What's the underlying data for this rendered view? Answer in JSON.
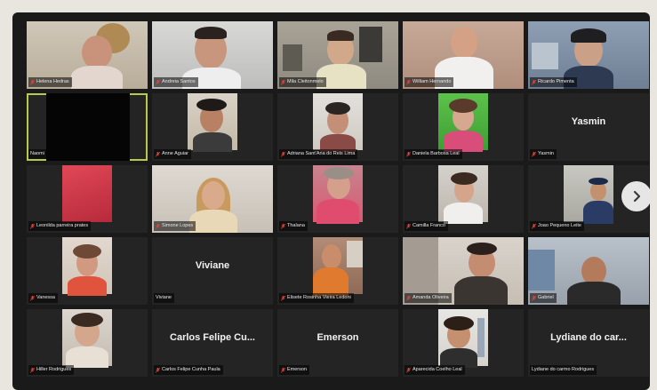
{
  "meeting": {
    "next_page_icon": "chevron-right-icon",
    "muted_icon": "mic-off-icon",
    "accent": "#b9c94a",
    "participants": [
      {
        "label": "Helena Hedras",
        "big_name": ""
      },
      {
        "label": "Andreia Santos",
        "big_name": ""
      },
      {
        "label": "Mila Cleitonmelo",
        "big_name": ""
      },
      {
        "label": "William Hernando",
        "big_name": ""
      },
      {
        "label": "Ricardo Pimenta",
        "big_name": ""
      },
      {
        "label": "Naomi",
        "big_name": ""
      },
      {
        "label": "Anne Aguiar",
        "big_name": ""
      },
      {
        "label": "Adriana Sant'Ana do Reis Lima",
        "big_name": ""
      },
      {
        "label": "Daniela Barbosa Leal",
        "big_name": ""
      },
      {
        "label": "Yasmin",
        "big_name": "Yasmin"
      },
      {
        "label": "Leonilda parreira prates",
        "big_name": ""
      },
      {
        "label": "Simone Lopes",
        "big_name": ""
      },
      {
        "label": "Thalana",
        "big_name": ""
      },
      {
        "label": "Camilla Franco",
        "big_name": ""
      },
      {
        "label": "Joao Pequeno Leite",
        "big_name": ""
      },
      {
        "label": "Vanessa",
        "big_name": ""
      },
      {
        "label": "Viviane",
        "big_name": "Viviane"
      },
      {
        "label": "Elisete Rosinha Vieira Ledoni",
        "big_name": ""
      },
      {
        "label": "Amanda Oliveira",
        "big_name": ""
      },
      {
        "label": "Gabriel",
        "big_name": ""
      },
      {
        "label": "Hiller Rodrigues",
        "big_name": ""
      },
      {
        "label": "Carlos Felipe Cunha Paula",
        "big_name": "Carlos Felipe Cu..."
      },
      {
        "label": "Emerson",
        "big_name": "Emerson"
      },
      {
        "label": "Aparecida Coelho Leal",
        "big_name": ""
      },
      {
        "label": "Lydiane do carmo Rodrigues",
        "big_name": "Lydiane do car..."
      }
    ]
  }
}
